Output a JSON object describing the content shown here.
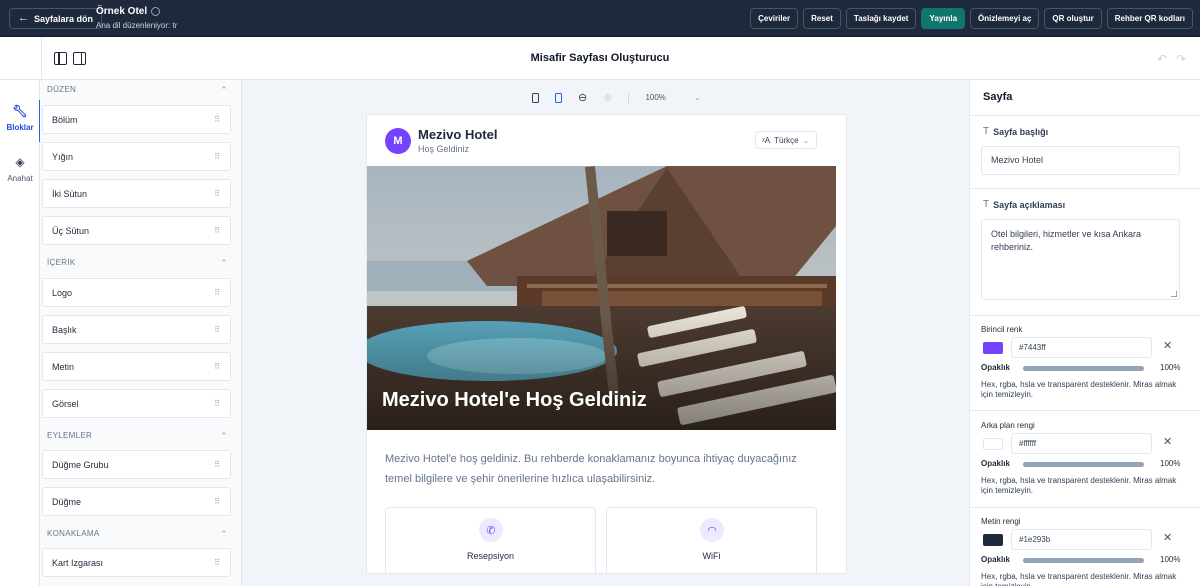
{
  "topbar": {
    "back_label": "Sayfalara dön",
    "site_title": "Örnek Otel",
    "site_subtitle": "Ana dil düzenleniyor: tr",
    "actions": [
      {
        "label": "Çeviriler"
      },
      {
        "label": "Reset"
      },
      {
        "label": "Taslağı kaydet"
      },
      {
        "label": "Yayınla"
      },
      {
        "label": "Önizlemeyi aç"
      },
      {
        "label": "QR oluştur"
      },
      {
        "label": "Rehber QR kodları"
      }
    ]
  },
  "builder": {
    "title": "Misafir Sayfası Oluşturucu",
    "undo_icon": "undo-icon",
    "redo_icon": "redo-icon"
  },
  "rail": {
    "items": [
      {
        "label": "Bloklar",
        "icon": "wrench-icon"
      },
      {
        "label": "Anahat",
        "icon": "layers-icon"
      }
    ]
  },
  "blocks": {
    "sections": [
      {
        "label": "DÜZEN",
        "items": [
          "Bölüm",
          "Yığın",
          "İki Sütun",
          "Üç Sütun"
        ]
      },
      {
        "label": "İÇERİK",
        "items": [
          "Logo",
          "Başlık",
          "Metin",
          "Görsel"
        ]
      },
      {
        "label": "EYLEMLER",
        "items": [
          "Düğme Grubu",
          "Düğme"
        ]
      },
      {
        "label": "KONAKLAMA",
        "items": [
          "Kart Izgarası"
        ]
      }
    ]
  },
  "canvas": {
    "zoom": "100%",
    "page": {
      "logo_letter": "M",
      "hotel_name": "Mezivo Hotel",
      "hotel_subtitle": "Hoş Geldiniz",
      "language": "Türkçe",
      "hero_title": "Mezivo Hotel'e Hoş Geldiniz",
      "intro": "Mezivo Hotel'e hoş geldiniz. Bu rehberde konaklamanız boyunca ihtiyaç duyacağınız temel bilgilere ve şehir önerilerine hızlıca ulaşabilirsiniz.",
      "cards": [
        {
          "title": "Resepsiyon",
          "icon": "phone-icon"
        },
        {
          "title": "WiFi",
          "icon": "wifi-icon"
        }
      ]
    }
  },
  "inspector": {
    "title": "Sayfa",
    "page_title_label": "Sayfa başlığı",
    "page_title_value": "Mezivo Hotel",
    "page_desc_label": "Sayfa açıklaması",
    "page_desc_value": "Otel bilgileri, hizmetler ve kısa Ankara rehberiniz.",
    "colors": [
      {
        "label": "Birincil renk",
        "hex": "#7443ff",
        "swatch": "#7443ff",
        "opacity_label": "Opaklık",
        "opacity": "100%",
        "opacity_value": 1.0,
        "help": "Hex, rgba, hsla ve transparent desteklenir. Miras almak için temizleyin."
      },
      {
        "label": "Arka plan rengi",
        "hex": "#ffffff",
        "swatch": "#ffffff",
        "opacity_label": "Opaklık",
        "opacity": "100%",
        "opacity_value": 1.0,
        "help": "Hex, rgba, hsla ve transparent desteklenir. Miras almak için temizleyin."
      },
      {
        "label": "Metin rengi",
        "hex": "#1e293b",
        "swatch": "#1e293b",
        "opacity_label": "Opaklık",
        "opacity": "100%",
        "opacity_value": 1.0,
        "help": "Hex, rgba, hsla ve transparent desteklenir. Miras almak için temizleyin."
      }
    ]
  },
  "colors": {
    "topbar": "#1e293b",
    "primary_action": "#0f766e",
    "brand": "#7443ff",
    "accent": "#2563eb"
  }
}
